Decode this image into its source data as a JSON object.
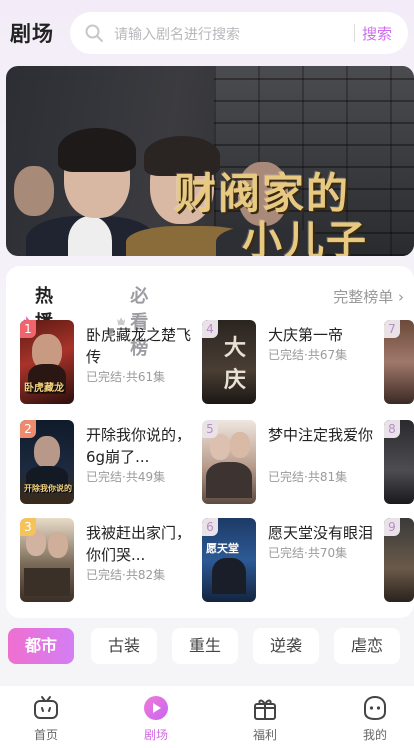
{
  "header": {
    "title": "剧场",
    "search_placeholder": "请输入剧名进行搜索",
    "search_button": "搜索"
  },
  "banner": {
    "title_line1": "财阀家的",
    "title_line2": "小儿子"
  },
  "ranking": {
    "tab_hot": "热播榜",
    "tab_must_watch": "必看榜",
    "full_list": "完整榜单",
    "items": [
      {
        "rank": "1",
        "name": "卧虎藏龙之楚飞传",
        "meta": "已完结·共61集",
        "cover_caption": "卧虎藏龙"
      },
      {
        "rank": "2",
        "name": "开除我你说的，6g崩了...",
        "meta": "已完结·共49集",
        "cover_caption": "开除我你说的"
      },
      {
        "rank": "3",
        "name": "我被赶出家门，你们哭...",
        "meta": "已完结·共82集",
        "cover_caption": ""
      },
      {
        "rank": "4",
        "name": "大庆第一帝",
        "meta": "已完结·共67集",
        "cover_caption": "大庆"
      },
      {
        "rank": "5",
        "name": "梦中注定我爱你",
        "meta": "已完结·共81集",
        "cover_caption": ""
      },
      {
        "rank": "6",
        "name": "愿天堂没有眼泪",
        "meta": "已完结·共70集",
        "cover_caption": "愿天堂"
      },
      {
        "rank": "7",
        "name": "",
        "meta": "",
        "cover_caption": ""
      },
      {
        "rank": "8",
        "name": "",
        "meta": "",
        "cover_caption": ""
      },
      {
        "rank": "9",
        "name": "",
        "meta": "",
        "cover_caption": ""
      }
    ]
  },
  "categories": [
    "都市",
    "古装",
    "重生",
    "逆袭",
    "虐恋"
  ],
  "tabbar": {
    "home": "首页",
    "theater": "剧场",
    "welfare": "福利",
    "mine": "我的"
  },
  "colors": {
    "accent": "#d56ae6",
    "rank_top": "#f0646e",
    "rank_mid": "#f0a06e",
    "rank_low": "#f5c35a"
  }
}
